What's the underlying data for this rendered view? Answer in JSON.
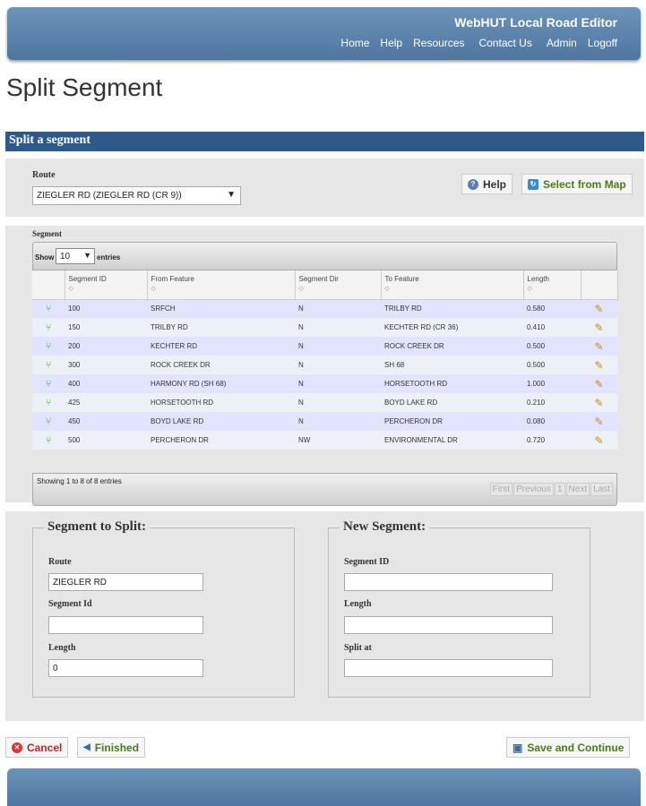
{
  "header": {
    "app_title": "WebHUT Local Road Editor",
    "nav": [
      "Home",
      "Help",
      "Resources",
      "Contact Us",
      "Admin",
      "Logoff"
    ]
  },
  "page_title": "Split Segment",
  "section_title": "Split a segment",
  "route": {
    "label": "Route",
    "selected": "ZIEGLER RD (ZIEGLER RD (CR 9))"
  },
  "buttons": {
    "help": "Help",
    "select_from_map": "Select from Map",
    "cancel": "Cancel",
    "finished": "Finished",
    "save_continue": "Save and Continue"
  },
  "segment_grid": {
    "label": "Segment",
    "show_label": "Show",
    "page_length": "10",
    "entries_label": "entries",
    "columns": [
      "Segment ID",
      "From Feature",
      "Segment Dir",
      "To Feature",
      "Length"
    ],
    "rows": [
      [
        "100",
        "SRFCH",
        "N",
        "TRILBY RD",
        "0.580"
      ],
      [
        "150",
        "TRILBY RD",
        "N",
        "KECHTER RD (CR 36)",
        "0.410"
      ],
      [
        "200",
        "KECHTER RD",
        "N",
        "ROCK CREEK DR",
        "0.500"
      ],
      [
        "300",
        "ROCK CREEK DR",
        "N",
        "SH 68",
        "0.500"
      ],
      [
        "400",
        "HARMONY RD (SH 68)",
        "N",
        "HORSETOOTH RD",
        "1.000"
      ],
      [
        "425",
        "HORSETOOTH RD",
        "N",
        "BOYD LAKE RD",
        "0.210"
      ],
      [
        "450",
        "BOYD LAKE RD",
        "N",
        "PERCHERON DR",
        "0.080"
      ],
      [
        "500",
        "PERCHERON DR",
        "NW",
        "ENVIRONMENTAL DR",
        "0.720"
      ]
    ],
    "info": "Showing 1 to 8 of 8 entries",
    "pager": [
      "First",
      "Previous",
      "1",
      "Next",
      "Last"
    ]
  },
  "split_form": {
    "legend": "Segment to Split:",
    "route_label": "Route",
    "route_value": "ZIEGLER  RD",
    "segment_id_label": "Segment Id",
    "segment_id_value": "",
    "length_label": "Length",
    "length_value": "0"
  },
  "new_form": {
    "legend": "New Segment:",
    "segment_id_label": "Segment ID",
    "segment_id_value": "",
    "length_label": "Length",
    "length_value": "",
    "split_at_label": "Split at",
    "split_at_value": ""
  },
  "colors": {
    "header_blue": "#5a82aa",
    "section_blue": "#2d5a8a",
    "green_text": "#4a7a1a",
    "red_text": "#cc2222"
  }
}
